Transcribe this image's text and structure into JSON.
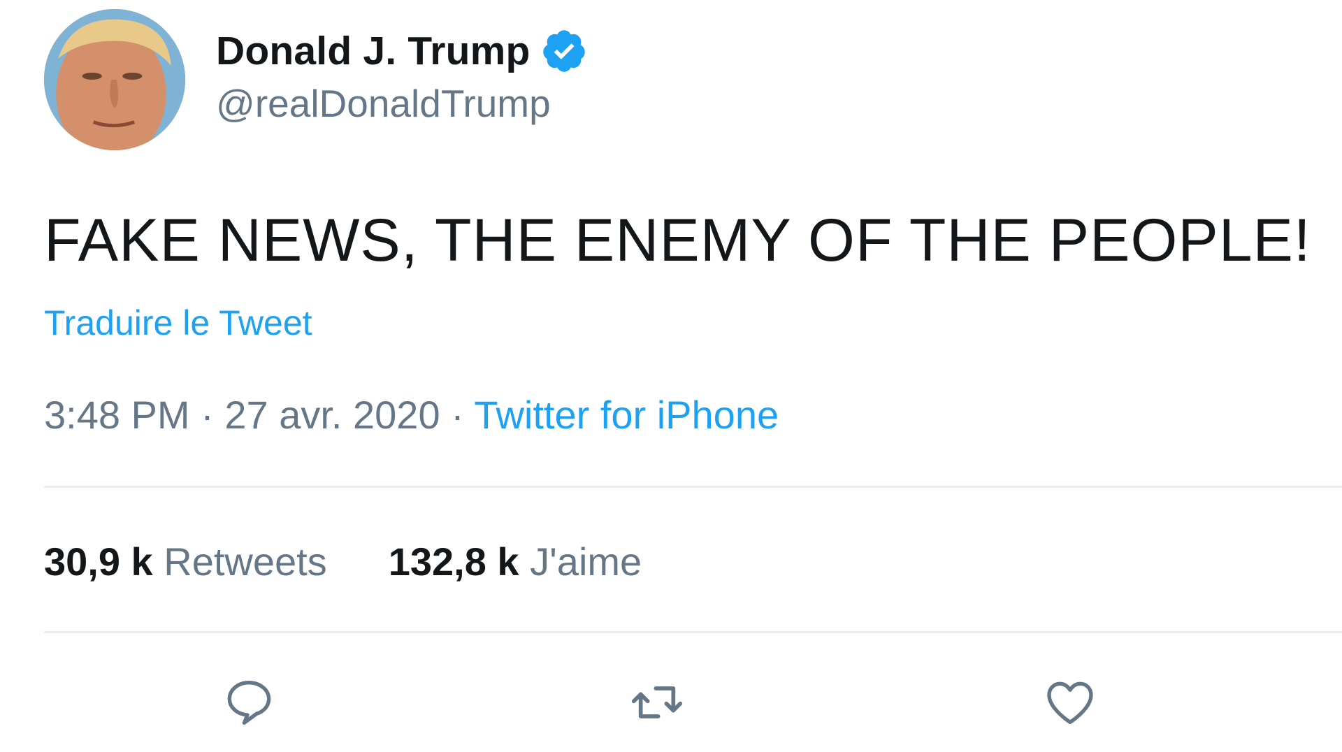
{
  "author": {
    "display_name": "Donald J. Trump",
    "handle": "@realDonaldTrump",
    "verified_icon": "verified-badge-icon",
    "avatar": "profile-photo"
  },
  "tweet": {
    "text": "FAKE NEWS, THE ENEMY OF THE PEOPLE!",
    "translate_label": "Traduire le Tweet",
    "time": "3:48 PM",
    "separator": "·",
    "date": "27 avr. 2020",
    "source": "Twitter for iPhone"
  },
  "stats": {
    "retweets": {
      "count": "30,9 k",
      "label": "Retweets"
    },
    "likes": {
      "count": "132,8 k",
      "label": "J'aime"
    }
  },
  "actions": {
    "reply_icon": "reply-icon",
    "retweet_icon": "retweet-icon",
    "like_icon": "heart-icon"
  },
  "colors": {
    "text": "#14171a",
    "secondary": "#657786",
    "accent": "#1da1f2",
    "divider": "#e6ecf0"
  }
}
